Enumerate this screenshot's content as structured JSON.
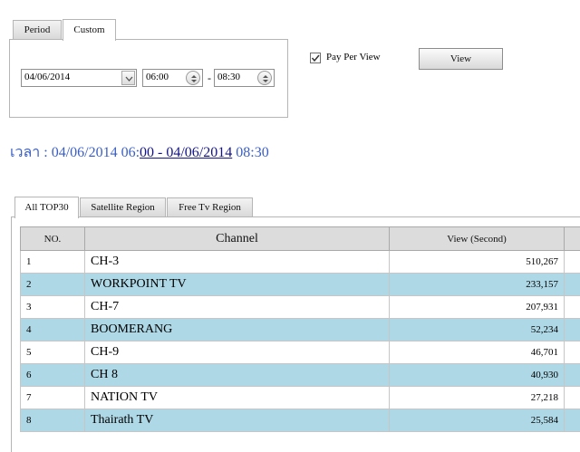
{
  "filter_tabs": [
    "Period",
    "Custom"
  ],
  "filter": {
    "date": "04/06/2014",
    "start_time": "06:00",
    "time_separator": "-",
    "end_time": "08:30",
    "pay_per_view_label": "Pay Per View",
    "pay_per_view_checked": true,
    "view_button": "View"
  },
  "time_range": {
    "prefix": "เวลา : 04/06/2014 06:",
    "link": "00 - 04/06/2014",
    "suffix": " 08:30"
  },
  "result_tabs": [
    "All TOP30",
    "Satellite Region",
    "Free Tv Region"
  ],
  "table": {
    "headers": [
      "NO.",
      "Channel",
      "View (Second)"
    ],
    "rows": [
      {
        "no": "1",
        "channel": "CH-3",
        "views": "510,267"
      },
      {
        "no": "2",
        "channel": "WORKPOINT TV",
        "views": "233,157"
      },
      {
        "no": "3",
        "channel": "CH-7",
        "views": "207,931"
      },
      {
        "no": "4",
        "channel": "BOOMERANG",
        "views": "52,234"
      },
      {
        "no": "5",
        "channel": "CH-9",
        "views": "46,701"
      },
      {
        "no": "6",
        "channel": "CH 8",
        "views": "40,930"
      },
      {
        "no": "7",
        "channel": "NATION TV",
        "views": "27,218"
      },
      {
        "no": "8",
        "channel": "Thairath TV",
        "views": "25,584"
      }
    ]
  },
  "colors": {
    "row_alt": "#aed8e6",
    "header": "#dcdcdc",
    "time_text": "#3a5fc6",
    "time_link": "#141488"
  }
}
